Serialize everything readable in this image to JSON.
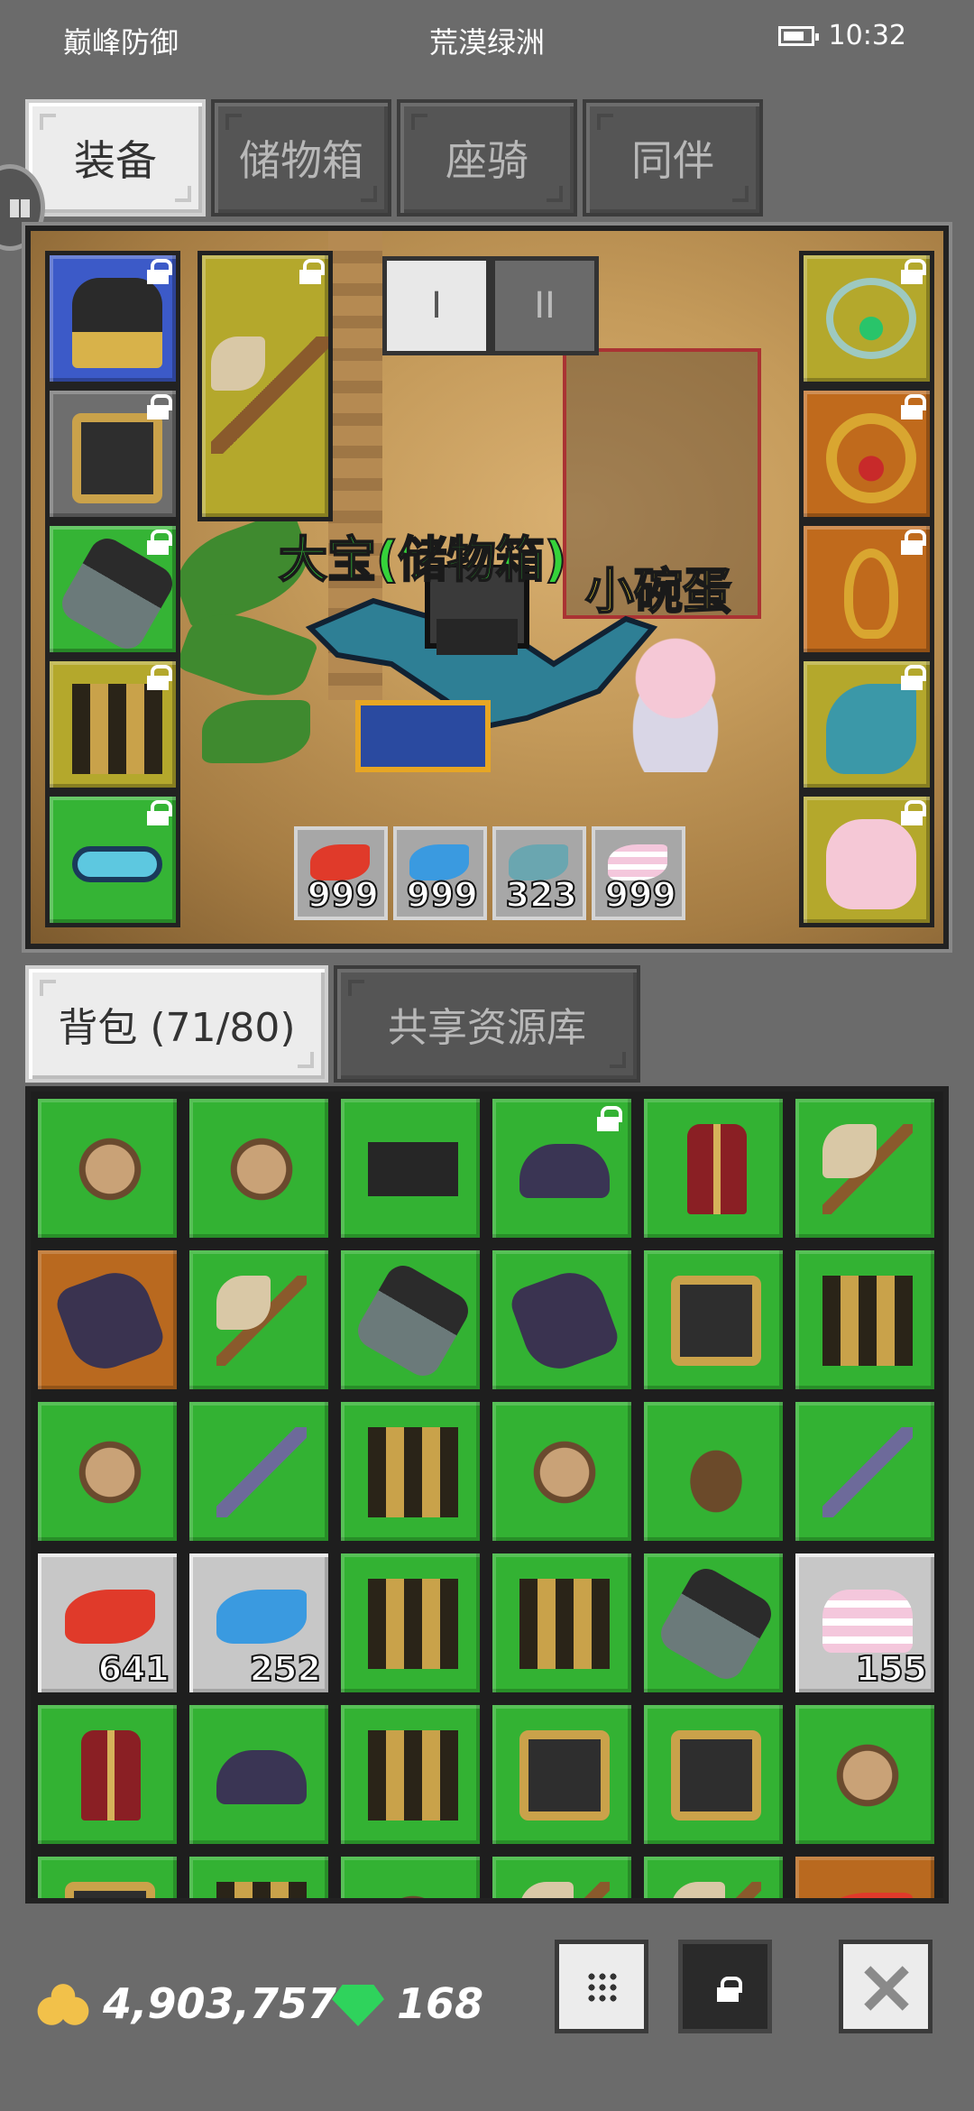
{
  "status_bar": {
    "left_text": "巅峰防御",
    "center_text": "荒漠绿洲",
    "time": "10:32"
  },
  "top_tabs": [
    {
      "label": "装备",
      "active": true
    },
    {
      "label": "储物箱",
      "active": false
    },
    {
      "label": "座骑",
      "active": false
    },
    {
      "label": "同伴",
      "active": false
    }
  ],
  "equipment": {
    "page_buttons": [
      "I",
      "II"
    ],
    "character_name": "大宝(储物箱)",
    "companion_name": "小碗蛋",
    "left_slots": [
      {
        "name": "helmet",
        "color": "#3c5ac8",
        "locked": true
      },
      {
        "name": "chest-armor",
        "color": "#6e6e6e",
        "locked": true
      },
      {
        "name": "gauntlet",
        "color": "#35b435",
        "locked": true
      },
      {
        "name": "pants",
        "color": "#b4a82c",
        "locked": true
      },
      {
        "name": "belt",
        "color": "#35b435",
        "locked": true
      }
    ],
    "weapon_slot": {
      "name": "axe",
      "color": "#b4a82c",
      "locked": true
    },
    "right_slots": [
      {
        "name": "amulet",
        "color": "#b4a82c",
        "locked": true
      },
      {
        "name": "ring",
        "color": "#c06a1c",
        "locked": true
      },
      {
        "name": "earring",
        "color": "#c06a1c",
        "locked": true
      },
      {
        "name": "mount-dino",
        "color": "#b4a82c",
        "locked": true
      },
      {
        "name": "pet-egg",
        "color": "#b4a82c",
        "locked": true
      }
    ],
    "resources": [
      {
        "icon": "red-feather-icon",
        "count": "999"
      },
      {
        "icon": "blue-feather-icon",
        "count": "999"
      },
      {
        "icon": "fish-icon",
        "count": "323"
      },
      {
        "icon": "cake-icon",
        "count": "999"
      }
    ]
  },
  "bag_tabs": [
    {
      "label": "背包 (71/80)",
      "active": true
    },
    {
      "label": "共享资源库",
      "active": false
    }
  ],
  "bag_items": [
    {
      "icon": "armor",
      "bg": "green"
    },
    {
      "icon": "armor",
      "bg": "green"
    },
    {
      "icon": "helmet",
      "bg": "green"
    },
    {
      "icon": "cap",
      "bg": "green",
      "locked": true
    },
    {
      "icon": "robe",
      "bg": "green"
    },
    {
      "icon": "axe",
      "bg": "green"
    },
    {
      "icon": "glove",
      "bg": "orange"
    },
    {
      "icon": "axe",
      "bg": "green"
    },
    {
      "icon": "gauntlet",
      "bg": "green"
    },
    {
      "icon": "glove",
      "bg": "green"
    },
    {
      "icon": "chest",
      "bg": "green"
    },
    {
      "icon": "pants",
      "bg": "green"
    },
    {
      "icon": "armor",
      "bg": "green"
    },
    {
      "icon": "sword",
      "bg": "green"
    },
    {
      "icon": "pants",
      "bg": "green"
    },
    {
      "icon": "armor",
      "bg": "green"
    },
    {
      "icon": "vest",
      "bg": "green"
    },
    {
      "icon": "sword",
      "bg": "green"
    },
    {
      "icon": "feather-red",
      "bg": "silver",
      "count": "641"
    },
    {
      "icon": "feather-blue",
      "bg": "silver",
      "count": "252"
    },
    {
      "icon": "pants",
      "bg": "green"
    },
    {
      "icon": "pants",
      "bg": "green"
    },
    {
      "icon": "gauntlet",
      "bg": "green"
    },
    {
      "icon": "cake",
      "bg": "silver",
      "count": "155"
    },
    {
      "icon": "robe",
      "bg": "green"
    },
    {
      "icon": "cap",
      "bg": "green"
    },
    {
      "icon": "pants",
      "bg": "green"
    },
    {
      "icon": "chest",
      "bg": "green"
    },
    {
      "icon": "chest",
      "bg": "green"
    },
    {
      "icon": "armor",
      "bg": "green"
    },
    {
      "icon": "chest",
      "bg": "green"
    },
    {
      "icon": "pants",
      "bg": "green"
    },
    {
      "icon": "armor",
      "bg": "green"
    },
    {
      "icon": "axe",
      "bg": "green"
    },
    {
      "icon": "axe",
      "bg": "green"
    },
    {
      "icon": "feather-red",
      "bg": "orange"
    }
  ],
  "currency": {
    "gold": "4,903,757",
    "gems": "168"
  },
  "bottom_buttons": [
    {
      "name": "grid-view-button",
      "icon": "grid-icon"
    },
    {
      "name": "lock-button",
      "icon": "lock-icon"
    },
    {
      "name": "close-button",
      "icon": "close-icon"
    }
  ],
  "colors": {
    "background": "#6b6b6b",
    "slot_green": "#33b233",
    "slot_orange": "#b9691f",
    "slot_silver": "#c7c7c7",
    "name_green": "#35d23a",
    "name_yellow": "#f1d23a"
  }
}
